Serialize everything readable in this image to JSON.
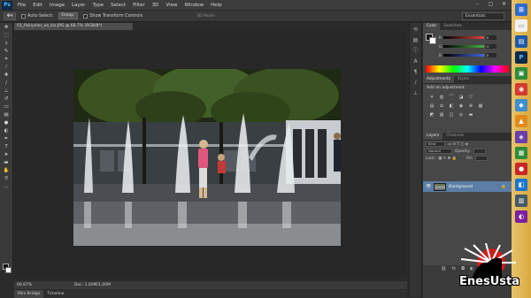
{
  "app": {
    "logo": "Ps"
  },
  "menu": [
    "File",
    "Edit",
    "Image",
    "Layer",
    "Type",
    "Select",
    "Filter",
    "3D",
    "View",
    "Window",
    "Help"
  ],
  "window_controls": [
    "–",
    "▢",
    "✕"
  ],
  "options_bar": {
    "tool_glyph": "✥▾",
    "auto_select_label": "Auto-Select:",
    "auto_select_value": "Group",
    "transform_label": "Show Transform Controls",
    "mode_label": "3D Mode:",
    "workspace": "Essentials"
  },
  "document": {
    "tab_title": "01_fiskiyeler_ve_kiz.JPG @ 66.7% (RGB/8*)",
    "zoom": "66.67%",
    "doc_size": "Doc: 1,00M/1,00M"
  },
  "bottom_tabs": [
    "Mini Bridge",
    "Timeline"
  ],
  "color_panel": {
    "tabs": [
      "Color",
      "Swatches"
    ],
    "sliders": [
      {
        "label": "R",
        "value": "0",
        "color": "#e04444"
      },
      {
        "label": "G",
        "value": "0",
        "color": "#44b044"
      },
      {
        "label": "B",
        "value": "0",
        "color": "#4466e0"
      }
    ]
  },
  "adjustments_panel": {
    "tabs": [
      "Adjustments",
      "Styles"
    ],
    "title": "Add an adjustment"
  },
  "layers_panel": {
    "tabs": [
      "Layers",
      "Channels"
    ],
    "kind": "Kind",
    "blend_mode": "Normal",
    "opacity_label": "Opacity:",
    "lock_label": "Lock:",
    "fill_label": "Fill:",
    "layer_name": "Background"
  },
  "watermark": {
    "text": "EnesUsta"
  },
  "accent_color": "#5b7da6"
}
